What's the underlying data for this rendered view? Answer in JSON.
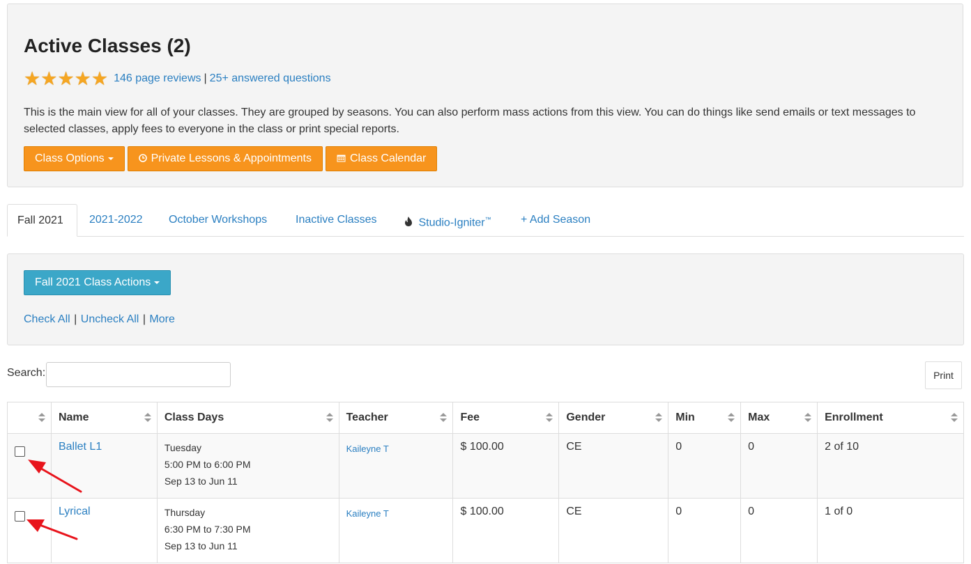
{
  "header": {
    "title": "Active Classes (2)",
    "reviews_link": "146 page reviews",
    "separator": "|",
    "questions_link": "25+ answered questions",
    "description": "This is the main view for all of your classes. They are grouped by seasons. You can also perform mass actions from this view. You can do things like send emails or text messages to selected classes, apply fees to everyone in the class or print special reports.",
    "star_color": "#f5a623"
  },
  "buttons": {
    "class_options": "Class Options",
    "private_lessons": "Private Lessons & Appointments",
    "class_calendar": "Class Calendar",
    "accent_color": "#f7941d"
  },
  "tabs": [
    {
      "label": "Fall 2021",
      "active": true
    },
    {
      "label": "2021-2022"
    },
    {
      "label": "October Workshops"
    },
    {
      "label": "Inactive Classes"
    },
    {
      "label": "Studio-Igniter",
      "mark": "™"
    },
    {
      "label": "+ Add Season"
    }
  ],
  "season_actions": {
    "button": "Fall 2021 Class Actions",
    "check_all": "Check All",
    "uncheck_all": "Uncheck All",
    "more": "More",
    "sep": "|",
    "button_color": "#3ba7c8"
  },
  "search": {
    "label": "Search:",
    "value": ""
  },
  "print_label": "Print",
  "table": {
    "columns": [
      "",
      "Name",
      "Class Days",
      "Teacher",
      "Fee",
      "Gender",
      "Min",
      "Max",
      "Enrollment"
    ],
    "rows": [
      {
        "checked": false,
        "name": "Ballet L1",
        "day": "Tuesday",
        "time": "5:00 PM to 6:00 PM",
        "dates": "Sep 13 to Jun 11",
        "teacher": "Kaileyne T",
        "fee": "$ 100.00",
        "gender": "CE",
        "min": "0",
        "max": "0",
        "enrollment": "2 of 10"
      },
      {
        "checked": false,
        "name": "Lyrical",
        "day": "Thursday",
        "time": "6:30 PM to 7:30 PM",
        "dates": "Sep 13 to Jun 11",
        "teacher": "Kaileyne T",
        "fee": "$ 100.00",
        "gender": "CE",
        "min": "0",
        "max": "0",
        "enrollment": "1 of 0"
      }
    ]
  },
  "annotation_color": "#e8141c"
}
